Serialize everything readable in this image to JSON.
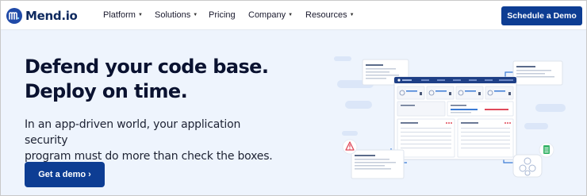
{
  "brand": {
    "name": "Mend.io",
    "primary_color": "#0d3d93",
    "logo_color": "#1f4aa8"
  },
  "nav": {
    "items": [
      {
        "label": "Platform",
        "has_dropdown": true
      },
      {
        "label": "Solutions",
        "has_dropdown": true
      },
      {
        "label": "Pricing",
        "has_dropdown": false
      },
      {
        "label": "Company",
        "has_dropdown": true
      },
      {
        "label": "Resources",
        "has_dropdown": true
      }
    ],
    "cta_label": "Schedule a Demo"
  },
  "hero": {
    "title_line1": "Defend your code base.",
    "title_line2": "Deploy on time.",
    "subtitle_line1": "In an app-driven world, your application security",
    "subtitle_line2": "program must do more than check the boxes.",
    "cta_label": "Get a demo ›"
  },
  "illustration": {
    "icons": [
      "warning-icon",
      "document-icon",
      "dependency-graph-icon"
    ],
    "accent_colors": {
      "warning": "#e04a5a",
      "document": "#3bb56b",
      "window_header": "#1e3f86"
    }
  }
}
